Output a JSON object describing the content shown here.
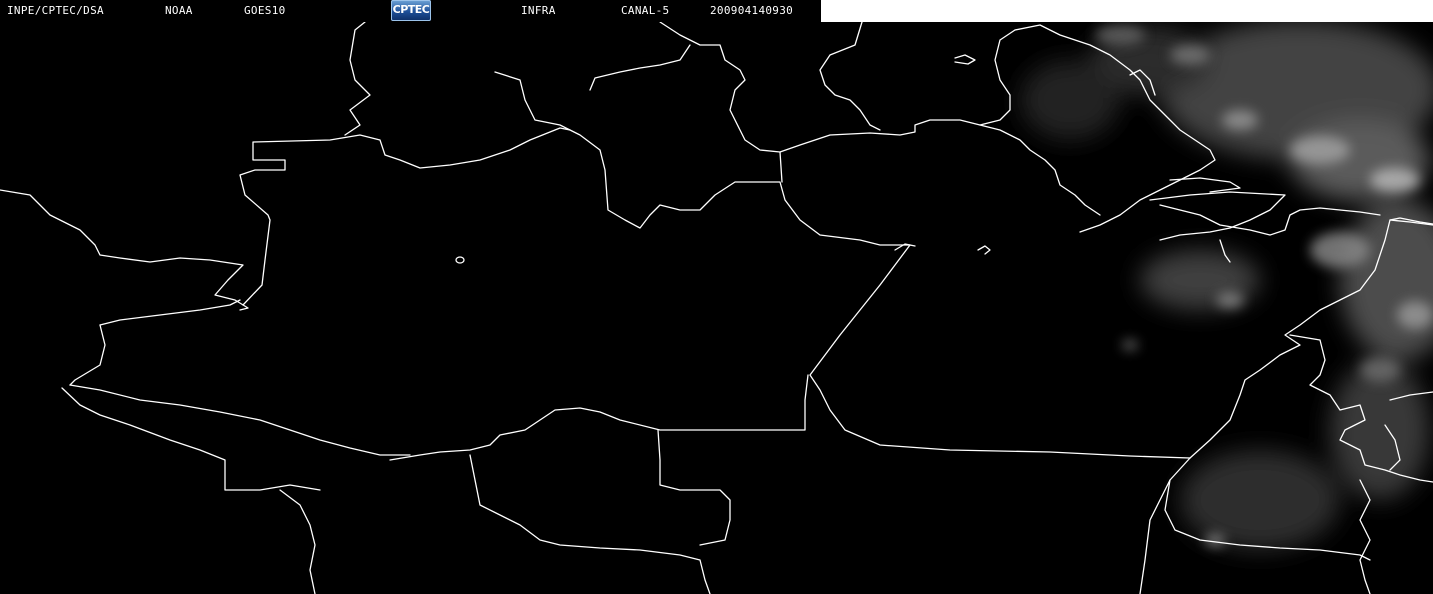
{
  "header": {
    "institution": "INPE/CPTEC/DSA",
    "agency": "NOAA",
    "satellite": "GOES10",
    "logo_text": "CPTEC",
    "product": "INFRA",
    "channel": "CANAL-5",
    "timestamp": "200904140930"
  },
  "colors": {
    "background": "#000000",
    "boundaries": "#ffffff",
    "clouds": "#a9a9a9",
    "header_strip": "#ffffff"
  }
}
